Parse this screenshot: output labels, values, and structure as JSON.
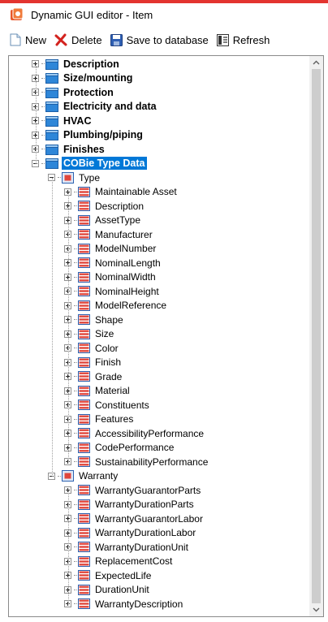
{
  "window": {
    "title": "Dynamic GUI editor - Item"
  },
  "toolbar": {
    "new_label": "New",
    "delete_label": "Delete",
    "save_label": "Save to database",
    "refresh_label": "Refresh"
  },
  "tree": {
    "categories": [
      {
        "label": "Description",
        "icon": "blue-folder-icon"
      },
      {
        "label": "Size/mounting",
        "icon": "blue-folder-icon"
      },
      {
        "label": "Protection",
        "icon": "blue-folder-icon"
      },
      {
        "label": "Electricity and data",
        "icon": "blue-folder-icon"
      },
      {
        "label": "HVAC",
        "icon": "blue-folder-icon"
      },
      {
        "label": "Plumbing/piping",
        "icon": "blue-folder-icon"
      },
      {
        "label": "Finishes",
        "icon": "blue-folder-icon"
      },
      {
        "label": "COBie Type Data",
        "icon": "blue-folder-icon",
        "selected": true
      }
    ],
    "type_group": {
      "label": "Type",
      "items": [
        "Maintainable Asset",
        "Description",
        "AssetType",
        "Manufacturer",
        "ModelNumber",
        "NominalLength",
        "NominalWidth",
        "NominalHeight",
        "ModelReference",
        "Shape",
        "Size",
        "Color",
        "Finish",
        "Grade",
        "Material",
        "Constituents",
        "Features",
        "AccessibilityPerformance",
        "CodePerformance",
        "SustainabilityPerformance"
      ]
    },
    "warranty_group": {
      "label": "Warranty",
      "items": [
        "WarrantyGuarantorParts",
        "WarrantyDurationParts",
        "WarrantyGuarantorLabor",
        "WarrantyDurationLabor",
        "WarrantyDurationUnit",
        "ReplacementCost",
        "ExpectedLife",
        "DurationUnit",
        "WarrantyDescription"
      ]
    }
  },
  "colors": {
    "accent": "#e3342f",
    "selection": "#0078d7",
    "folder_blue": "#2e86d8",
    "field_red": "#e0463c"
  }
}
